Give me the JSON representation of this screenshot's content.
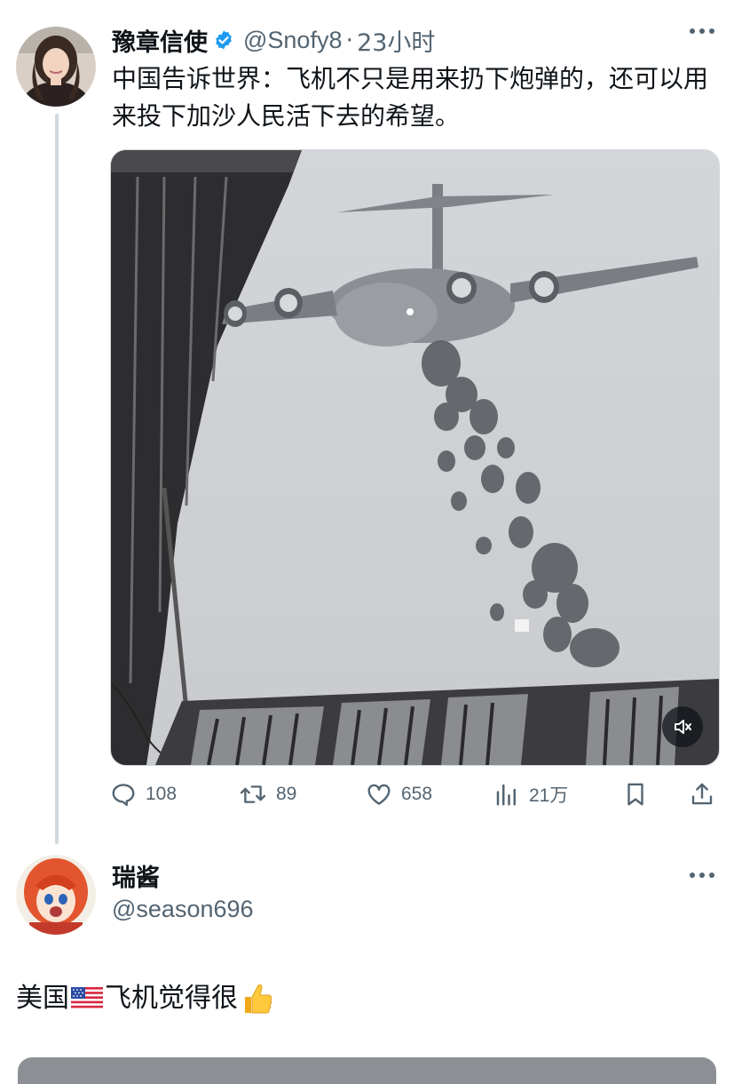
{
  "tweet": {
    "author_name": "豫章信使",
    "handle": "@Snofy8",
    "separator": "·",
    "time": "23小时",
    "text": "中国告诉世界：飞机不只是用来扔下炮弹的，还可以用来投下加沙人民活下去的希望。",
    "verified_color": "#1d9bf0",
    "media": {
      "type": "video",
      "muted": true
    }
  },
  "actions": {
    "replies": "108",
    "retweets": "89",
    "likes": "658",
    "views": "21万"
  },
  "reply": {
    "author_name": "瑞酱",
    "handle": "@season696",
    "text_before": "美国",
    "text_after": "飞机觉得很",
    "emojis": [
      "us-flag",
      "thumbs-up"
    ]
  },
  "colors": {
    "text": "#0f1419",
    "secondary": "#536471",
    "border": "#cfd9de",
    "accent": "#1d9bf0"
  }
}
